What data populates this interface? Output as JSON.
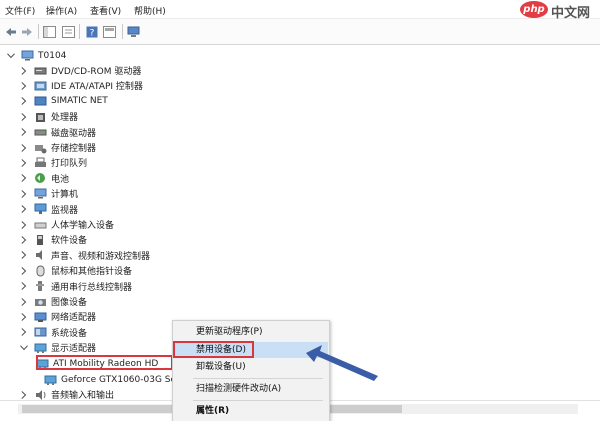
{
  "menubar": {
    "items": [
      {
        "label": "文件(F)"
      },
      {
        "label": "操作(A)"
      },
      {
        "label": "查看(V)"
      },
      {
        "label": "帮助(H)"
      }
    ]
  },
  "watermark": {
    "logo_text": "php",
    "site_text": "中文网"
  },
  "tree": {
    "root": {
      "label": "T0104"
    },
    "categories": [
      {
        "label": "DVD/CD-ROM 驱动器",
        "icon": "dvd-drive-icon"
      },
      {
        "label": "IDE ATA/ATAPI 控制器",
        "icon": "ide-controller-icon"
      },
      {
        "label": "SIMATIC NET",
        "icon": "network-component-icon"
      },
      {
        "label": "处理器",
        "icon": "processor-icon"
      },
      {
        "label": "磁盘驱动器",
        "icon": "disk-drive-icon"
      },
      {
        "label": "存储控制器",
        "icon": "storage-controller-icon"
      },
      {
        "label": "打印队列",
        "icon": "printer-icon"
      },
      {
        "label": "电池",
        "icon": "battery-icon"
      },
      {
        "label": "计算机",
        "icon": "computer-icon"
      },
      {
        "label": "监视器",
        "icon": "monitor-icon"
      },
      {
        "label": "人体学输入设备",
        "icon": "hid-icon"
      },
      {
        "label": "软件设备",
        "icon": "software-device-icon"
      },
      {
        "label": "声音、视频和游戏控制器",
        "icon": "speaker-icon"
      },
      {
        "label": "鼠标和其他指针设备",
        "icon": "mouse-icon"
      },
      {
        "label": "通用串行总线控制器",
        "icon": "usb-icon"
      },
      {
        "label": "图像设备",
        "icon": "camera-icon"
      },
      {
        "label": "网络适配器",
        "icon": "network-adapter-icon"
      },
      {
        "label": "系统设备",
        "icon": "system-device-icon"
      },
      {
        "label": "显示适配器",
        "icon": "display-adapter-icon",
        "expanded": true
      }
    ],
    "display_children": [
      {
        "label": "ATI Mobility Radeon HD",
        "selected": true
      },
      {
        "label": "Geforce GTX1060-03G Se"
      }
    ],
    "last": {
      "label": "音频输入和输出",
      "icon": "audio-io-icon"
    }
  },
  "context_menu": {
    "items": [
      {
        "label": "更新驱动程序(P)"
      },
      {
        "label": "禁用设备(D)",
        "highlighted": true
      },
      {
        "label": "卸载设备(U)"
      },
      {
        "label": "扫描检测硬件改动(A)"
      },
      {
        "label": "属性(R)",
        "bold": true
      }
    ]
  },
  "colors": {
    "highlight_border": "#d9363e",
    "menu_selection": "#c9dff5",
    "pointer_arrow": "#3b5da8"
  }
}
